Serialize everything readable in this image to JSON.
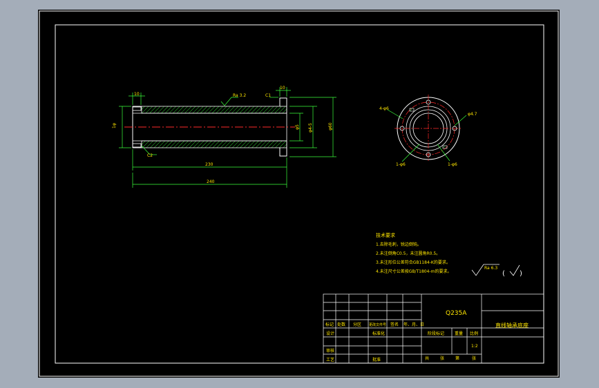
{
  "drawing": {
    "section_dims": {
      "chamfer_top_left": "10",
      "roughness_top": "Ra 3.2",
      "chamfer_c1": "C1",
      "width_right_top": "10",
      "dia_left": "1φ",
      "dia_inner": "φ5",
      "dia_mid": "φ4-5",
      "dia_outer": "φ60",
      "chamfer_c2": "C2",
      "len_inner": "230",
      "len_total": "240"
    },
    "end_view": {
      "label_left_top": "4-φ6",
      "label_right_top": "φ4.7",
      "label_bottom_left": "1-φ6",
      "label_bottom_right": "1-φ6"
    },
    "notes": {
      "title": "技术要求",
      "lines": [
        "1.去除毛刺，锐边倒钝。",
        "2.未注倒角C0.5，未注圆角R0.5。",
        "3.未注形位公差符合GB1184-K的要求。",
        "4.未注尺寸公差按GB/T1804-m的要求。"
      ]
    },
    "surface_symbol": "Ra 6.3",
    "title_block": {
      "material": "Q235A",
      "part_name": "直线轴承底座",
      "row_labels": [
        "标记",
        "处数",
        "分区",
        "更改文件号",
        "签名",
        "年、月、日"
      ],
      "design": "设计",
      "standardize": "标准化",
      "review": "审核",
      "process": "工艺",
      "approve": "批准",
      "stage_mark": "阶段标记",
      "weight": "重量",
      "scale": "比例",
      "scale_value": "1:2",
      "sheets_total": "共",
      "sheets_label": "张",
      "sheet_no": "第",
      "sheet_label": "张"
    }
  }
}
